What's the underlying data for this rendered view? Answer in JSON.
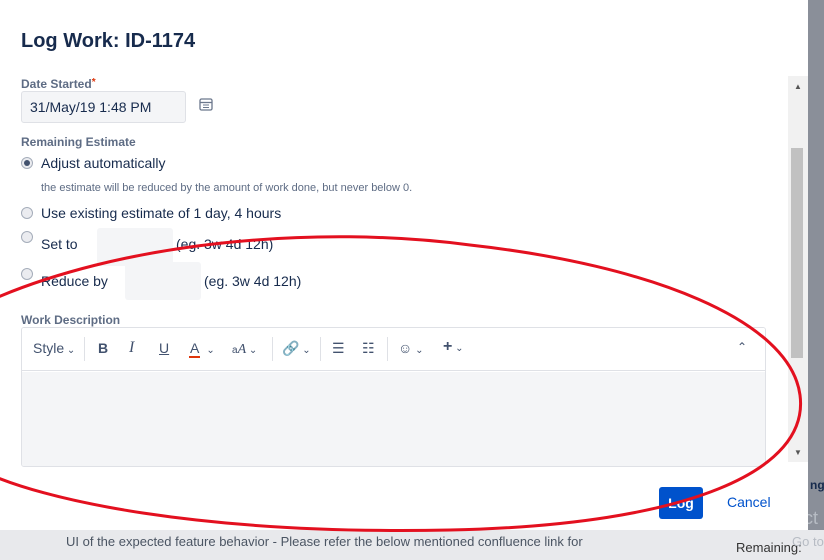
{
  "dialog": {
    "title": "Log Work: ID-1174"
  },
  "date_started": {
    "label": "Date Started",
    "required_mark": "*",
    "value": "31/May/19 1:48 PM"
  },
  "remaining_estimate": {
    "label": "Remaining Estimate",
    "options": [
      {
        "label": "Adjust automatically",
        "checked": true
      },
      {
        "label": "Use existing estimate of 1 day, 4 hours",
        "checked": false
      },
      {
        "label": "Set to",
        "checked": false,
        "hint": "(eg. 3w 4d 12h)"
      },
      {
        "label": "Reduce by",
        "checked": false,
        "hint": "(eg. 3w 4d 12h)"
      }
    ],
    "auto_hint": "the estimate will be reduced by the amount of work done, but never below 0."
  },
  "work_description": {
    "label": "Work Description",
    "toolbar": {
      "style": "Style",
      "bold": "B",
      "italic": "I",
      "underline": "U",
      "text_color": "A"
    }
  },
  "actions": {
    "log": "Log",
    "cancel": "Cancel"
  },
  "background": {
    "bottom_text": "UI of the expected feature behavior - Please refer the below mentioned confluence link for",
    "remaining": "Remaining:",
    "act": "Act",
    "go": "Go to",
    "ng": "ng"
  },
  "colors": {
    "primary": "#0052cc",
    "annotation": "#e3101f"
  }
}
